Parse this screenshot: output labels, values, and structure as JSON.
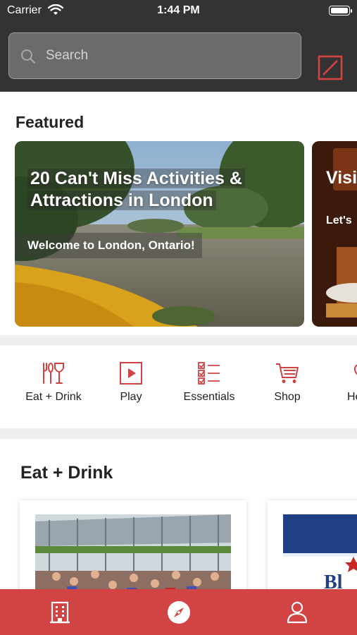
{
  "status_bar": {
    "carrier": "Carrier",
    "time": "1:44 PM"
  },
  "search": {
    "placeholder": "Search"
  },
  "icons": {
    "search": "search-icon",
    "scan": "scan-icon",
    "wifi": "wifi-icon",
    "battery": "battery-icon"
  },
  "colors": {
    "header_bg": "#333333",
    "accent_red": "#d24444",
    "text_dark": "#222222"
  },
  "featured": {
    "title": "Featured",
    "cards": [
      {
        "headline": "20 Can't Miss Activities & Attractions in London",
        "subtitle": "Welcome to London, Ontario!"
      },
      {
        "headline": "Visi",
        "subtitle": "Let's"
      }
    ]
  },
  "categories": [
    {
      "label": "Eat + Drink",
      "icon": "fork-wine-icon"
    },
    {
      "label": "Play",
      "icon": "play-icon"
    },
    {
      "label": "Essentials",
      "icon": "checklist-icon"
    },
    {
      "label": "Shop",
      "icon": "cart-icon"
    },
    {
      "label": "He",
      "icon": "heart-icon"
    }
  ],
  "eat_drink": {
    "title": "Eat + Drink"
  },
  "tabbar": [
    {
      "name": "tab-directory",
      "icon": "building-icon"
    },
    {
      "name": "tab-explore",
      "icon": "compass-icon"
    },
    {
      "name": "tab-profile",
      "icon": "person-icon"
    }
  ]
}
